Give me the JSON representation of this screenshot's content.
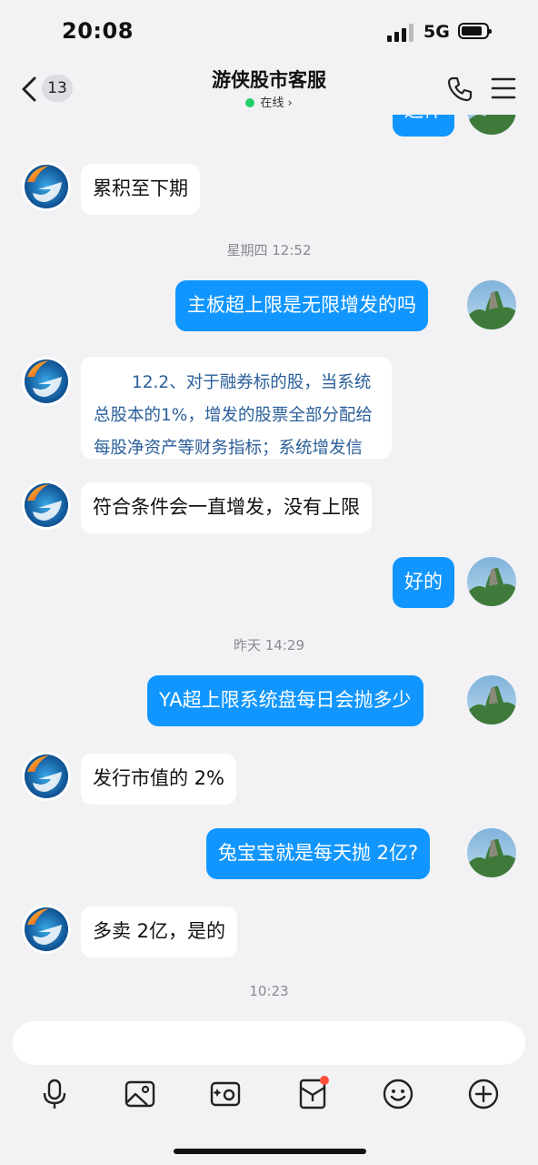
{
  "status": {
    "time": "20:08",
    "network": "5G"
  },
  "header": {
    "back_count": "13",
    "title": "游侠股市客服",
    "status": "在线",
    "status_chevron": "›"
  },
  "messages": {
    "top_partial": "送件",
    "m1": "累积至下期",
    "ts1": "星期四 12:52",
    "m2": "主板超上限是无限增发的吗",
    "doc_line1": "12.2、对于融券标的股，当系统",
    "doc_line2": "总股本的1%，增发的股票全部分配给",
    "doc_line3": "每股净资产等财务指标；系统增发信",
    "m3": "符合条件会一直增发，没有上限",
    "m4": "好的",
    "ts2": "昨天 14:29",
    "m5": "YA超上限系统盘每日会抛多少",
    "m6": "发行市值的 2%",
    "m7": "兔宝宝就是每天抛 2亿?",
    "m8": "多卖 2亿，是的",
    "ts3": "10:23"
  },
  "input": {
    "placeholder": ""
  },
  "toolbar": [
    "microphone-icon",
    "image-icon",
    "camera-icon",
    "red-packet-icon",
    "emoji-icon",
    "plus-icon"
  ],
  "colors": {
    "accent": "#1196ff",
    "background": "#f2f2f5",
    "online": "#22d06a",
    "badge_red": "#ff4d3a"
  }
}
